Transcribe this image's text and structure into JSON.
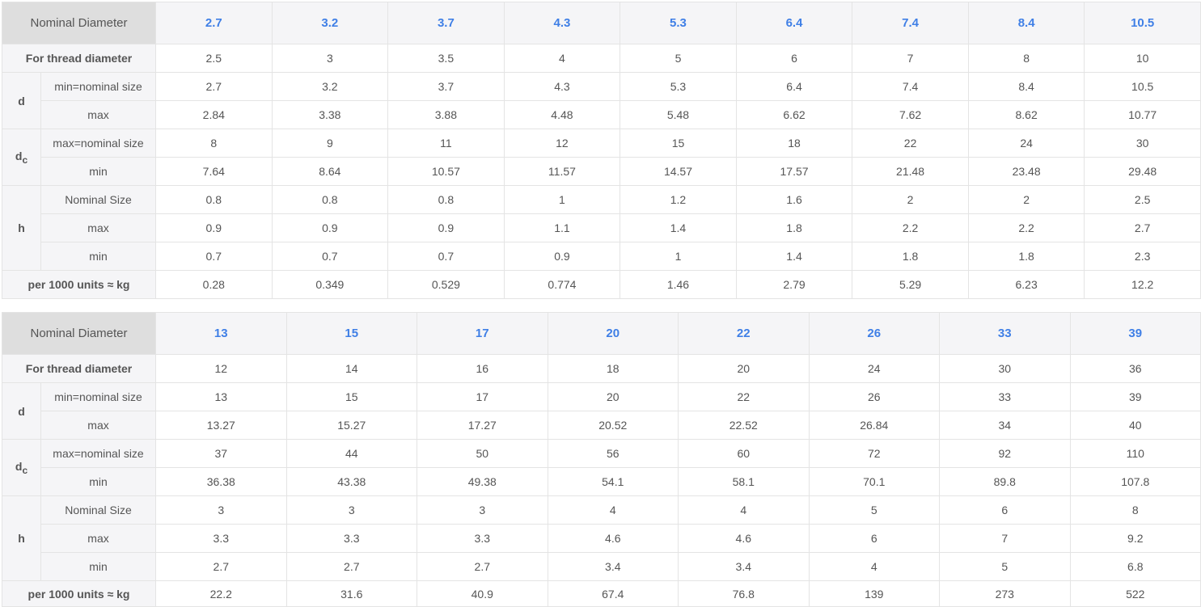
{
  "tables": [
    {
      "header_label": "Nominal Diameter",
      "diameters": [
        "2.7",
        "3.2",
        "3.7",
        "4.3",
        "5.3",
        "6.4",
        "7.4",
        "8.4",
        "10.5"
      ],
      "thread": {
        "label": "For thread diameter",
        "values": [
          "2.5",
          "3",
          "3.5",
          "4",
          "5",
          "6",
          "7",
          "8",
          "10"
        ]
      },
      "d": {
        "symbol": "d",
        "min_label": "min=nominal size",
        "min": [
          "2.7",
          "3.2",
          "3.7",
          "4.3",
          "5.3",
          "6.4",
          "7.4",
          "8.4",
          "10.5"
        ],
        "max_label": "max",
        "max": [
          "2.84",
          "3.38",
          "3.88",
          "4.48",
          "5.48",
          "6.62",
          "7.62",
          "8.62",
          "10.77"
        ]
      },
      "dc": {
        "symbol": "d",
        "subscript": "c",
        "max_label": "max=nominal size",
        "max": [
          "8",
          "9",
          "11",
          "12",
          "15",
          "18",
          "22",
          "24",
          "30"
        ],
        "min_label": "min",
        "min": [
          "7.64",
          "8.64",
          "10.57",
          "11.57",
          "14.57",
          "17.57",
          "21.48",
          "23.48",
          "29.48"
        ]
      },
      "h": {
        "symbol": "h",
        "nom_label": "Nominal Size",
        "nom": [
          "0.8",
          "0.8",
          "0.8",
          "1",
          "1.2",
          "1.6",
          "2",
          "2",
          "2.5"
        ],
        "max_label": "max",
        "max": [
          "0.9",
          "0.9",
          "0.9",
          "1.1",
          "1.4",
          "1.8",
          "2.2",
          "2.2",
          "2.7"
        ],
        "min_label": "min",
        "min": [
          "0.7",
          "0.7",
          "0.7",
          "0.9",
          "1",
          "1.4",
          "1.8",
          "1.8",
          "2.3"
        ]
      },
      "weight": {
        "label": "per 1000 units ≈ kg",
        "values": [
          "0.28",
          "0.349",
          "0.529",
          "0.774",
          "1.46",
          "2.79",
          "5.29",
          "6.23",
          "12.2"
        ]
      }
    },
    {
      "header_label": "Nominal Diameter",
      "diameters": [
        "13",
        "15",
        "17",
        "20",
        "22",
        "26",
        "33",
        "39"
      ],
      "thread": {
        "label": "For thread diameter",
        "values": [
          "12",
          "14",
          "16",
          "18",
          "20",
          "24",
          "30",
          "36"
        ]
      },
      "d": {
        "symbol": "d",
        "min_label": "min=nominal size",
        "min": [
          "13",
          "15",
          "17",
          "20",
          "22",
          "26",
          "33",
          "39"
        ],
        "max_label": "max",
        "max": [
          "13.27",
          "15.27",
          "17.27",
          "20.52",
          "22.52",
          "26.84",
          "34",
          "40"
        ]
      },
      "dc": {
        "symbol": "d",
        "subscript": "c",
        "max_label": "max=nominal size",
        "max": [
          "37",
          "44",
          "50",
          "56",
          "60",
          "72",
          "92",
          "110"
        ],
        "min_label": "min",
        "min": [
          "36.38",
          "43.38",
          "49.38",
          "54.1",
          "58.1",
          "70.1",
          "89.8",
          "107.8"
        ]
      },
      "h": {
        "symbol": "h",
        "nom_label": "Nominal Size",
        "nom": [
          "3",
          "3",
          "3",
          "4",
          "4",
          "5",
          "6",
          "8"
        ],
        "max_label": "max",
        "max": [
          "3.3",
          "3.3",
          "3.3",
          "4.6",
          "4.6",
          "6",
          "7",
          "9.2"
        ],
        "min_label": "min",
        "min": [
          "2.7",
          "2.7",
          "2.7",
          "3.4",
          "3.4",
          "4",
          "5",
          "6.8"
        ]
      },
      "weight": {
        "label": "per 1000 units ≈ kg",
        "values": [
          "22.2",
          "31.6",
          "40.9",
          "67.4",
          "76.8",
          "139",
          "273",
          "522"
        ]
      }
    }
  ]
}
